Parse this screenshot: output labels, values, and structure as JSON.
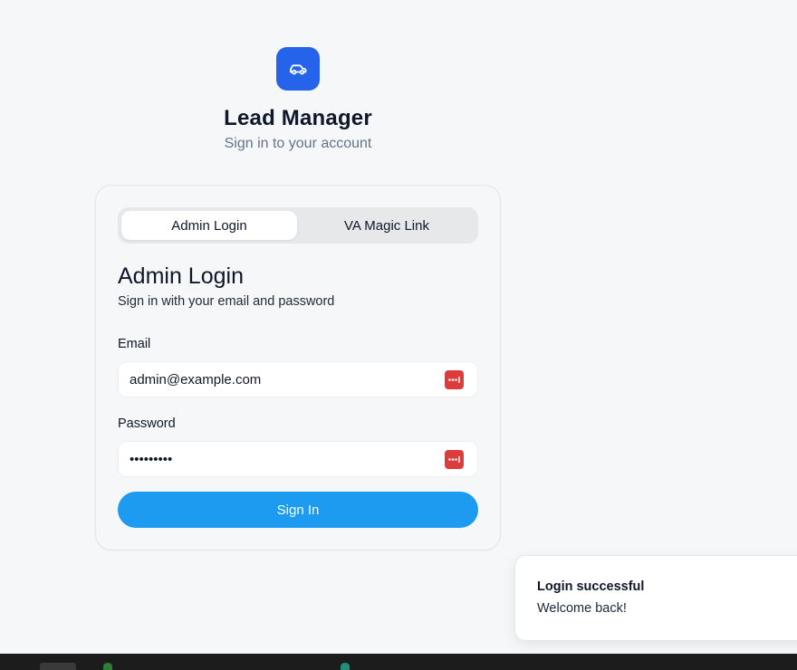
{
  "app": {
    "title": "Lead Manager",
    "subtitle": "Sign in to your account",
    "logo_icon": "car-icon",
    "brand_color": "#2563eb"
  },
  "tabs": [
    {
      "label": "Admin Login",
      "active": true
    },
    {
      "label": "VA Magic Link",
      "active": false
    }
  ],
  "form": {
    "title": "Admin Login",
    "subtitle": "Sign in with your email and password",
    "email": {
      "label": "Email",
      "value": "admin@example.com",
      "placeholder": ""
    },
    "password": {
      "label": "Password",
      "value": "password1",
      "placeholder": ""
    },
    "password_manager_icon": "password-manager-icon",
    "submit_label": "Sign In",
    "submit_color": "#1d9bf0"
  },
  "toast": {
    "title": "Login successful",
    "description": "Welcome back!"
  }
}
